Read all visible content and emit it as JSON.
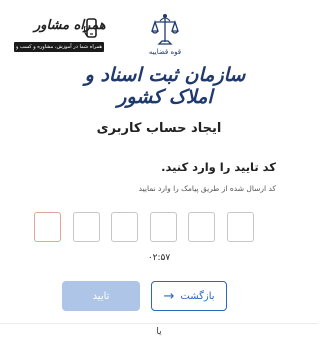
{
  "brand": {
    "name": "همراه مشاور",
    "tagline": "همراه شما در آموزش، مشاوره و کسب و کار",
    "bar_color": "#1b1b1b"
  },
  "organization": {
    "subtitle": "قوه قضاییه",
    "name": "سازمان ثبت اسناد و املاک کشور",
    "color": "#1f3a6b"
  },
  "page_title": "ایجاد حساب کاربری",
  "instructions": {
    "title": "کد تایید را وارد کنید.",
    "subtitle": "کد ارسال شده از طریق پیامک را وارد نمایید"
  },
  "otp": {
    "length": 6,
    "values": [
      "",
      "",
      "",
      "",
      "",
      ""
    ],
    "active_color": "#e0a59b"
  },
  "timer": "۰۲:۵۷",
  "buttons": {
    "confirm_label": "تایید",
    "confirm_color": "#aec5e7",
    "back_label": "بازگشت",
    "back_icon": "arrow-right-icon",
    "back_color": "#2a67c2"
  },
  "footer": {
    "text": "یا"
  }
}
